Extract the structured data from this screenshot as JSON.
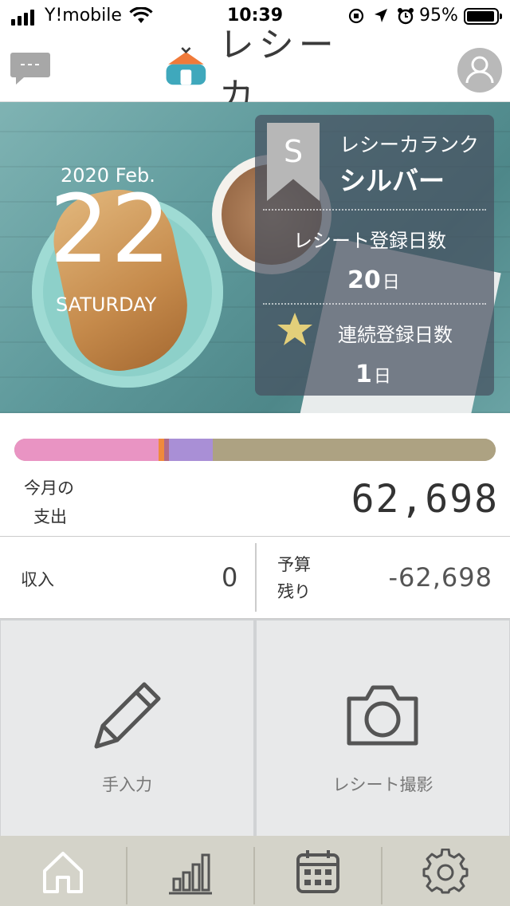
{
  "status_bar": {
    "carrier": "Y!mobile",
    "time": "10:39",
    "battery": "95%"
  },
  "header": {
    "app_name": "レシーカ",
    "chat_icon": "chat-bubble-icon",
    "profile_icon": "user-avatar-icon"
  },
  "hero": {
    "year_month": "2020 Feb.",
    "day": "22",
    "weekday": "SATURDAY",
    "rank": {
      "badge_letter": "S",
      "title": "レシーカランク",
      "value": "シルバー"
    },
    "registered_days": {
      "label": "レシート登録日数",
      "value": "20",
      "unit": "日"
    },
    "streak_days": {
      "label": "連続登録日数",
      "value": "1",
      "unit": "日"
    }
  },
  "spend_bar": {
    "segments": [
      {
        "fraction": 0.3,
        "color": "#e994c3"
      },
      {
        "fraction": 0.011,
        "color": "#f08a3c"
      },
      {
        "fraction": 0.011,
        "color": "#b06a88"
      },
      {
        "fraction": 0.09,
        "color": "#a98fd6"
      },
      {
        "fraction": 0.588,
        "color": "#ada282"
      }
    ]
  },
  "summary": {
    "monthly_spend_label_line1": "今月の",
    "monthly_spend_label_line2": "支出",
    "monthly_spend_value": "62,698",
    "income_label": "収入",
    "income_value": "0",
    "budget_label_line1": "予算",
    "budget_label_line2": "残り",
    "budget_value": "-62,698"
  },
  "actions": {
    "manual_label": "手入力",
    "manual_icon": "pencil-icon",
    "camera_label": "レシート撮影",
    "camera_icon": "camera-icon"
  },
  "tabbar": {
    "tabs": [
      {
        "icon": "home-icon"
      },
      {
        "icon": "bar-chart-icon"
      },
      {
        "icon": "calendar-icon"
      },
      {
        "icon": "gear-icon"
      }
    ]
  }
}
